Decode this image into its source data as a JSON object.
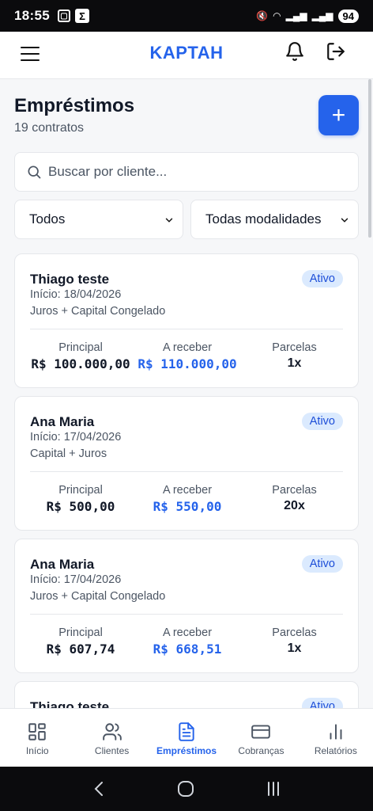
{
  "status_bar": {
    "time": "18:55",
    "sigma": "Σ",
    "battery": "94"
  },
  "header": {
    "brand": "KAPTAH"
  },
  "page": {
    "title": "Empréstimos",
    "subtitle": "19 contratos",
    "add_label": "+"
  },
  "search": {
    "placeholder": "Buscar por cliente..."
  },
  "filters": {
    "status": "Todos",
    "modality": "Todas modalidades"
  },
  "cards": [
    {
      "name": "Thiago teste",
      "start": "Início: 18/04/2026",
      "mode": "Juros + Capital Congelado",
      "badge": "Ativo",
      "principal_label": "Principal",
      "principal": "R$ 100.000,00",
      "receber_label": "A receber",
      "receber": "R$ 110.000,00",
      "parcelas_label": "Parcelas",
      "parcelas": "1x"
    },
    {
      "name": "Ana Maria",
      "start": "Início: 17/04/2026",
      "mode": "Capital + Juros",
      "badge": "Ativo",
      "principal_label": "Principal",
      "principal": "R$ 500,00",
      "receber_label": "A receber",
      "receber": "R$ 550,00",
      "parcelas_label": "Parcelas",
      "parcelas": "20x"
    },
    {
      "name": "Ana Maria",
      "start": "Início: 17/04/2026",
      "mode": "Juros + Capital Congelado",
      "badge": "Ativo",
      "principal_label": "Principal",
      "principal": "R$ 607,74",
      "receber_label": "A receber",
      "receber": "R$ 668,51",
      "parcelas_label": "Parcelas",
      "parcelas": "1x"
    },
    {
      "name": "Thiago teste",
      "badge": "Ativo"
    }
  ],
  "bottom_nav": [
    {
      "label": "Início",
      "icon": "grid-icon"
    },
    {
      "label": "Clientes",
      "icon": "users-icon"
    },
    {
      "label": "Empréstimos",
      "icon": "document-icon",
      "active": true
    },
    {
      "label": "Cobranças",
      "icon": "card-icon"
    },
    {
      "label": "Relatórios",
      "icon": "bar-chart-icon"
    }
  ],
  "colors": {
    "accent": "#2563eb",
    "badge_bg": "#dbeafe",
    "badge_text": "#1d4ed8"
  }
}
